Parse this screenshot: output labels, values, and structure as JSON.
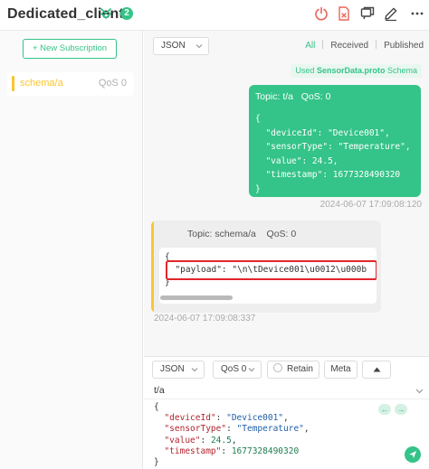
{
  "header": {
    "client_name": "Dedicated_client",
    "connection_count": "2",
    "accent_color": "#34c388",
    "disconnect_color": "#e9635a",
    "icons": [
      "chevron-double-down-icon",
      "power-icon",
      "delete-file-icon",
      "new-window-icon",
      "edit-icon",
      "more-icon"
    ]
  },
  "sidebar": {
    "new_subscription_label": "+ New Subscription",
    "subscriptions": [
      {
        "topic": "schema/a",
        "qos": "QoS 0",
        "color": "#fbc531"
      }
    ]
  },
  "messages": {
    "format_select": "JSON",
    "filter_tabs": {
      "all": "All",
      "received": "Received",
      "published": "Published",
      "active": "All"
    },
    "schema_note": {
      "prefix": "Used",
      "name": "SensorData.proto",
      "suffix": "Schema"
    },
    "items": [
      {
        "direction": "out",
        "topic_label": "Topic: t/a",
        "qos_label": "QoS: 0",
        "payload": "{\n  \"deviceId\": \"Device001\",\n  \"sensorType\": \"Temperature\",\n  \"value\": 24.5,\n  \"timestamp\": 1677328490320\n}",
        "time": "2024-06-07 17:09:08:120"
      },
      {
        "direction": "in",
        "topic_label": "Topic: schema/a",
        "qos_label": "QoS: 0",
        "payload": "{\n  \"payload\": \"\\n\\tDevice001\\u0012\\u000b\n}",
        "time": "2024-06-07 17:09:08:337",
        "highlight_color": "#e0262a"
      }
    ]
  },
  "publish": {
    "format_select": "JSON",
    "qos_select": "QoS 0",
    "retain_label": "Retain",
    "meta_label": "Meta",
    "topic": "t/a",
    "payload_lines": [
      {
        "open": "{"
      },
      {
        "key": "\"deviceId\"",
        "sep": ": ",
        "val": "\"Device001\"",
        "type": "s",
        "end": ","
      },
      {
        "key": "\"sensorType\"",
        "sep": ": ",
        "val": "\"Temperature\"",
        "type": "s",
        "end": ","
      },
      {
        "key": "\"value\"",
        "sep": ": ",
        "val": "24.5",
        "type": "n",
        "end": ","
      },
      {
        "key": "\"timestamp\"",
        "sep": ": ",
        "val": "1677328490320",
        "type": "n",
        "end": ""
      },
      {
        "open": "}"
      }
    ]
  }
}
